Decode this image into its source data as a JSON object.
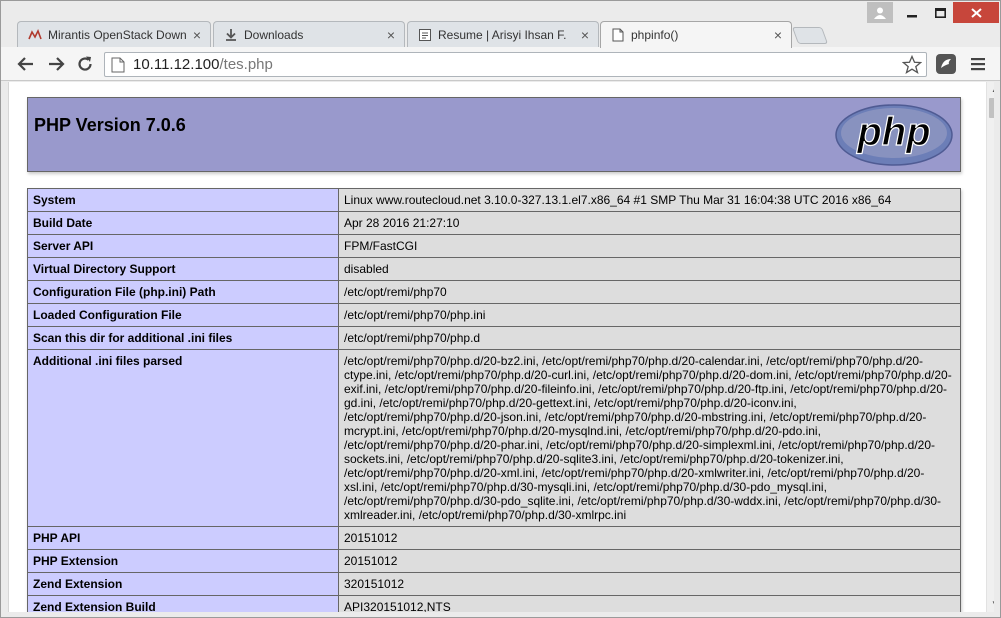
{
  "browser": {
    "tabs": [
      {
        "title": "Mirantis OpenStack Down",
        "icon": "mirantis-icon"
      },
      {
        "title": "Downloads",
        "icon": "download-icon"
      },
      {
        "title": "Resume | Arisyi Ihsan F.",
        "icon": "document-icon"
      },
      {
        "title": "phpinfo()",
        "icon": "page-icon",
        "active": true
      }
    ],
    "url_host": "10.11.12.100",
    "url_path": "/tes.php"
  },
  "php": {
    "version_title": "PHP Version 7.0.6",
    "logo_text": "php",
    "rows": [
      {
        "key": "System",
        "value": "Linux www.routecloud.net 3.10.0-327.13.1.el7.x86_64 #1 SMP Thu Mar 31 16:04:38 UTC 2016 x86_64"
      },
      {
        "key": "Build Date",
        "value": "Apr 28 2016 21:27:10"
      },
      {
        "key": "Server API",
        "value": "FPM/FastCGI"
      },
      {
        "key": "Virtual Directory Support",
        "value": "disabled"
      },
      {
        "key": "Configuration File (php.ini) Path",
        "value": "/etc/opt/remi/php70"
      },
      {
        "key": "Loaded Configuration File",
        "value": "/etc/opt/remi/php70/php.ini"
      },
      {
        "key": "Scan this dir for additional .ini files",
        "value": "/etc/opt/remi/php70/php.d"
      },
      {
        "key": "Additional .ini files parsed",
        "value": "/etc/opt/remi/php70/php.d/20-bz2.ini, /etc/opt/remi/php70/php.d/20-calendar.ini, /etc/opt/remi/php70/php.d/20-ctype.ini, /etc/opt/remi/php70/php.d/20-curl.ini, /etc/opt/remi/php70/php.d/20-dom.ini, /etc/opt/remi/php70/php.d/20-exif.ini, /etc/opt/remi/php70/php.d/20-fileinfo.ini, /etc/opt/remi/php70/php.d/20-ftp.ini, /etc/opt/remi/php70/php.d/20-gd.ini, /etc/opt/remi/php70/php.d/20-gettext.ini, /etc/opt/remi/php70/php.d/20-iconv.ini, /etc/opt/remi/php70/php.d/20-json.ini, /etc/opt/remi/php70/php.d/20-mbstring.ini, /etc/opt/remi/php70/php.d/20-mcrypt.ini, /etc/opt/remi/php70/php.d/20-mysqlnd.ini, /etc/opt/remi/php70/php.d/20-pdo.ini, /etc/opt/remi/php70/php.d/20-phar.ini, /etc/opt/remi/php70/php.d/20-simplexml.ini, /etc/opt/remi/php70/php.d/20-sockets.ini, /etc/opt/remi/php70/php.d/20-sqlite3.ini, /etc/opt/remi/php70/php.d/20-tokenizer.ini, /etc/opt/remi/php70/php.d/20-xml.ini, /etc/opt/remi/php70/php.d/20-xmlwriter.ini, /etc/opt/remi/php70/php.d/20-xsl.ini, /etc/opt/remi/php70/php.d/30-mysqli.ini, /etc/opt/remi/php70/php.d/30-pdo_mysql.ini, /etc/opt/remi/php70/php.d/30-pdo_sqlite.ini, /etc/opt/remi/php70/php.d/30-wddx.ini, /etc/opt/remi/php70/php.d/30-xmlreader.ini, /etc/opt/remi/php70/php.d/30-xmlrpc.ini"
      },
      {
        "key": "PHP API",
        "value": "20151012"
      },
      {
        "key": "PHP Extension",
        "value": "20151012"
      },
      {
        "key": "Zend Extension",
        "value": "320151012"
      },
      {
        "key": "Zend Extension Build",
        "value": "API320151012,NTS"
      }
    ]
  },
  "colors": {
    "header_bg": "#9999cc",
    "key_bg": "#ccccff",
    "value_bg": "#dddddd",
    "close_button": "#c7463b"
  }
}
